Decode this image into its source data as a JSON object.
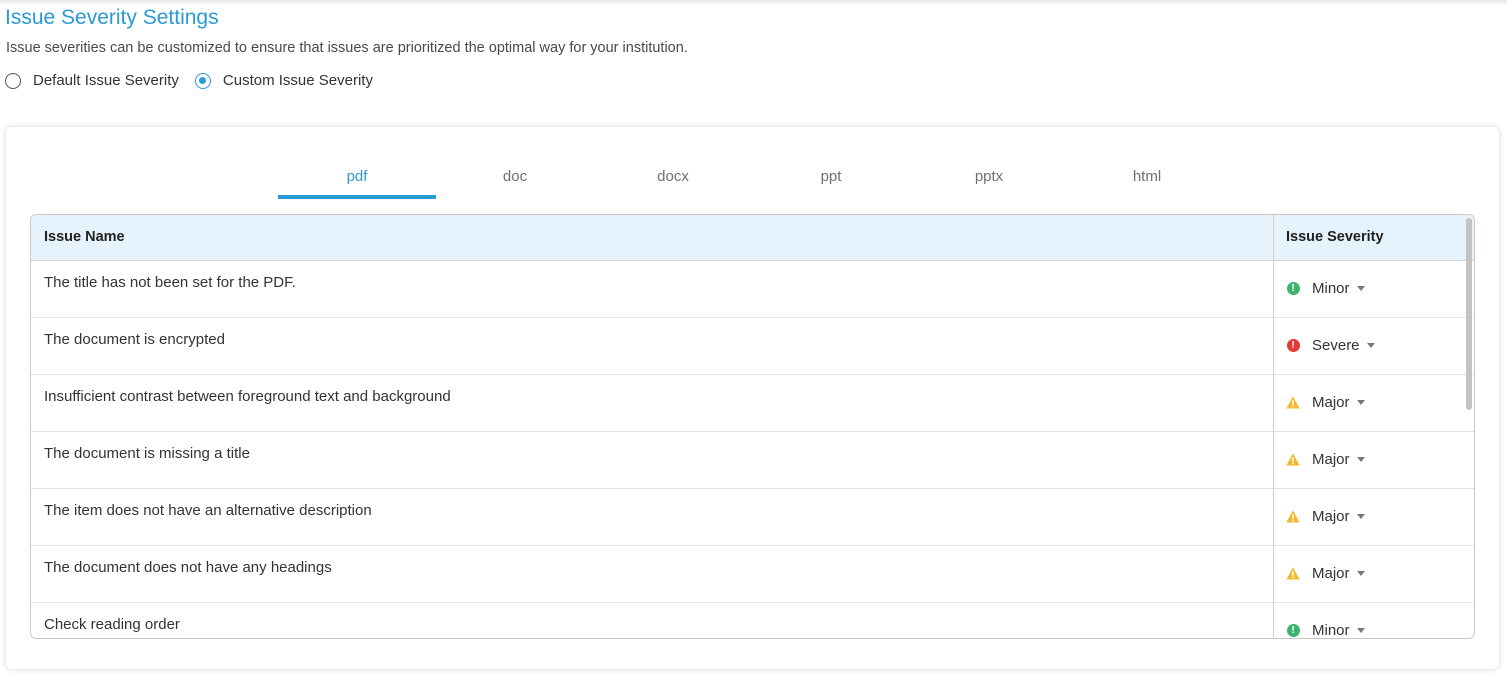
{
  "header": {
    "title": "Issue Severity Settings",
    "description": "Issue severities can be customized to ensure that issues are prioritized the optimal way for your institution."
  },
  "radios": {
    "default_label": "Default Issue Severity",
    "custom_label": "Custom Issue Severity",
    "selected": "custom"
  },
  "tabs": [
    {
      "label": "pdf",
      "active": true
    },
    {
      "label": "doc"
    },
    {
      "label": "docx"
    },
    {
      "label": "ppt"
    },
    {
      "label": "pptx"
    },
    {
      "label": "html"
    }
  ],
  "table": {
    "headers": {
      "name": "Issue Name",
      "severity": "Issue Severity"
    },
    "rows": [
      {
        "name": "The title has not been set for the PDF.",
        "severity": "Minor",
        "icon": "minor-icon"
      },
      {
        "name": "The document is encrypted",
        "severity": "Severe",
        "icon": "severe-icon"
      },
      {
        "name": "Insufficient contrast between foreground text and background",
        "severity": "Major",
        "icon": "warning-icon"
      },
      {
        "name": "The document is missing a title",
        "severity": "Major",
        "icon": "warning-icon"
      },
      {
        "name": "The item does not have an alternative description",
        "severity": "Major",
        "icon": "warning-icon"
      },
      {
        "name": "The document does not have any headings",
        "severity": "Major",
        "icon": "warning-icon"
      },
      {
        "name": "Check reading order",
        "severity": "Minor",
        "icon": "minor-icon"
      }
    ]
  },
  "colors": {
    "accent": "#2a9ad6",
    "minor": "#3cb371",
    "severe": "#e53935",
    "major": "#f5b82e"
  }
}
